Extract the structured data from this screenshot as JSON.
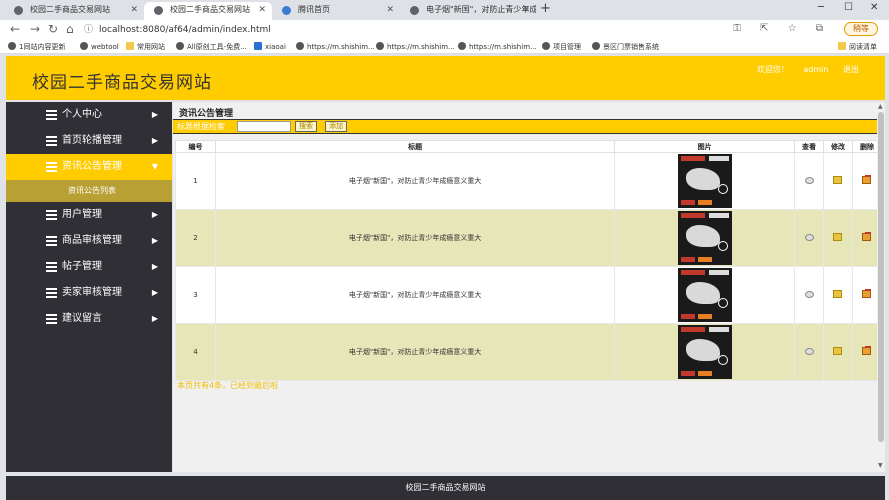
{
  "browser": {
    "tabs": [
      {
        "label": "校园二手商品交易网站",
        "active": false
      },
      {
        "label": "校园二手商品交易网站",
        "active": true
      },
      {
        "label": "腾讯首页",
        "active": false
      },
      {
        "label": "电子烟\"新国\"，对防止青少年成...",
        "active": false
      }
    ],
    "new_tab": "+",
    "url": "localhost:8080/af64/admin/index.html",
    "sync_label": "稍等",
    "bookmarks": [
      "1同站内容更新",
      "webtool",
      "常用网站",
      "All原创工具-免费...",
      "xiaoai",
      "https://m.shishim...",
      "https://m.shishim...",
      "https://m.shishim...",
      "项目管理",
      "景区门票销售系统",
      "阅读清单"
    ]
  },
  "header": {
    "title": "校园二手商品交易网站",
    "links": [
      "欢迎您！",
      "admin",
      "退出"
    ]
  },
  "sidebar": {
    "items": [
      {
        "label": "个人中心",
        "active": false
      },
      {
        "label": "首页轮播管理",
        "active": false
      },
      {
        "label": "资讯公告管理",
        "active": true
      },
      {
        "label": "用户管理",
        "active": false
      },
      {
        "label": "商品审核管理",
        "active": false
      },
      {
        "label": "帖子管理",
        "active": false
      },
      {
        "label": "卖家审核管理",
        "active": false
      },
      {
        "label": "建议留言",
        "active": false
      }
    ],
    "submenu": [
      "资讯公告列表"
    ]
  },
  "main": {
    "heading": "资讯公告管理",
    "search_label": "标题根据检索",
    "search_value": "",
    "search_button": "搜索",
    "add_button": "添加",
    "columns": [
      "编号",
      "标题",
      "图片",
      "查看",
      "修改",
      "删除"
    ],
    "rows": [
      {
        "id": "1",
        "title": "电子烟\"新国\"，对防止青少年成瘾意义重大"
      },
      {
        "id": "2",
        "title": "电子烟\"新国\"，对防止青少年成瘾意义重大"
      },
      {
        "id": "3",
        "title": "电子烟\"新国\"，对防止青少年成瘾意义重大"
      },
      {
        "id": "4",
        "title": "电子烟\"新国\"，对防止青少年成瘾意义重大"
      }
    ],
    "pager": "本页共有4条，已经到最后啦"
  },
  "footer": {
    "text": "校园二手商品交易网站"
  }
}
